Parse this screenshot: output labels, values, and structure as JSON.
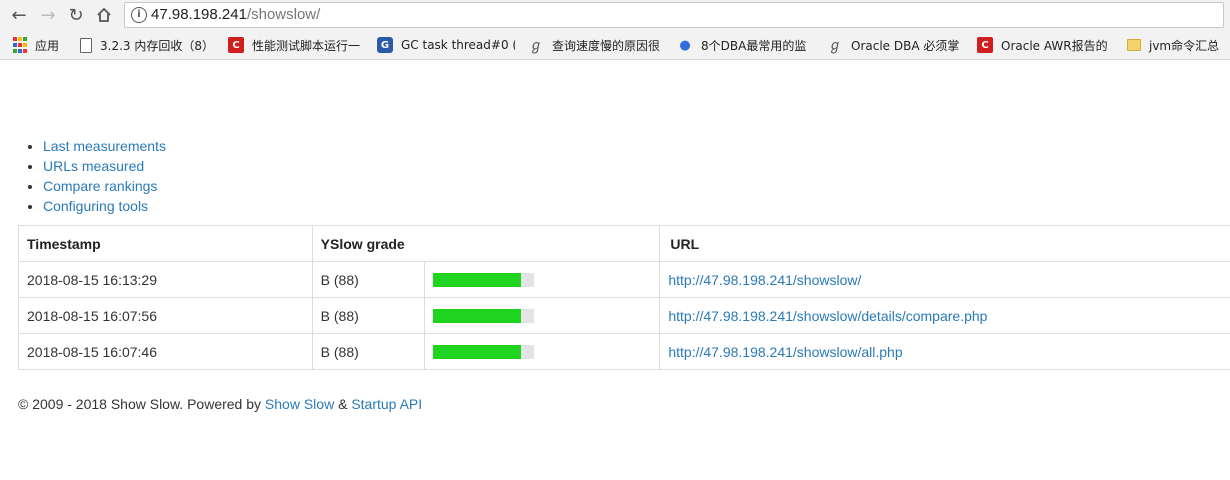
{
  "browser": {
    "url_host": "47.98.198.241",
    "url_path": "/showslow/",
    "bookmarks": [
      {
        "label": "应用",
        "icon": "apps-grid-icon"
      },
      {
        "label": "3.2.3 内存回收（8）",
        "icon": "document-icon"
      },
      {
        "label": "性能测试脚本运行一",
        "icon": "csdn-icon"
      },
      {
        "label": "GC task thread#0 (",
        "icon": "cnblogs-icon"
      },
      {
        "label": "查询速度慢的原因很",
        "icon": "gc-site-icon"
      },
      {
        "label": "8个DBA最常用的监",
        "icon": "baidu-paw-icon"
      },
      {
        "label": "Oracle DBA 必须掌",
        "icon": "gc-site-icon"
      },
      {
        "label": "Oracle AWR报告的",
        "icon": "csdn-icon"
      },
      {
        "label": "jvm命令汇总",
        "icon": "folder-icon"
      }
    ]
  },
  "nav": {
    "items": [
      "Last measurements",
      "URLs measured",
      "Compare rankings",
      "Configuring tools"
    ]
  },
  "table": {
    "headers": {
      "timestamp": "Timestamp",
      "grade": "YSlow grade",
      "url": "URL"
    },
    "rows": [
      {
        "timestamp": "2018-08-15 16:13:29",
        "grade": "B (88)",
        "score": 0.88,
        "url": "http://47.98.198.241/showslow/"
      },
      {
        "timestamp": "2018-08-15 16:07:56",
        "grade": "B (88)",
        "score": 0.88,
        "url": "http://47.98.198.241/showslow/details/compare.php"
      },
      {
        "timestamp": "2018-08-15 16:07:46",
        "grade": "B (88)",
        "score": 0.88,
        "url": "http://47.98.198.241/showslow/all.php"
      }
    ],
    "bar_color": "#1ed41e"
  },
  "footer": {
    "prefix": "© 2009 - 2018 Show Slow. Powered by ",
    "link1": "Show Slow",
    "amp": " & ",
    "link2": "Startup API"
  }
}
